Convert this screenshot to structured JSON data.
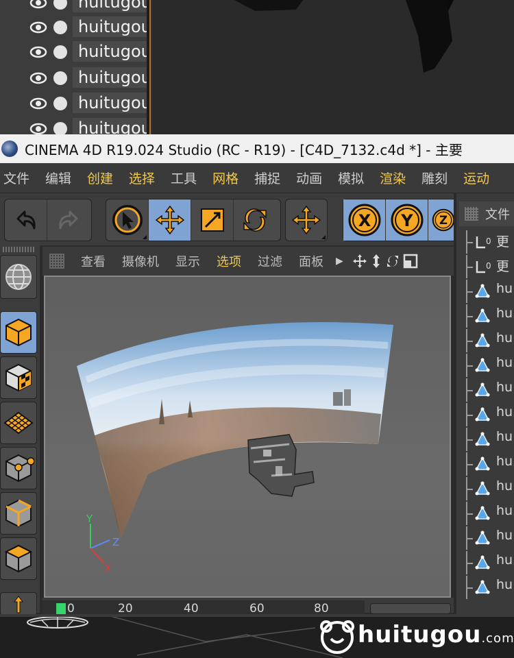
{
  "top_panel": {
    "rows": [
      {
        "label": "huitugou"
      },
      {
        "label": "huitugou"
      },
      {
        "label": "huitugou"
      },
      {
        "label": "huitugou"
      },
      {
        "label": "huitugou"
      },
      {
        "label": "huitugou"
      }
    ]
  },
  "window": {
    "title": "CINEMA 4D R19.024 Studio (RC - R19) - [C4D_7132.c4d *] - 主要"
  },
  "menubar": {
    "items": [
      "文件",
      "编辑",
      "创建",
      "选择",
      "工具",
      "网格",
      "捕捉",
      "动画",
      "模拟",
      "渲染",
      "雕刻",
      "运动"
    ],
    "highlighted": [
      "创建",
      "选择",
      "网格",
      "渲染",
      "运动"
    ]
  },
  "toolbar": {
    "undo": "undo-icon",
    "redo": "redo-icon",
    "tools": [
      "select-arrow-icon",
      "move-icon",
      "scale-icon",
      "rotate-icon",
      "move-icon"
    ],
    "axes": [
      "X",
      "Y",
      "Z"
    ]
  },
  "viewport": {
    "menu": [
      "查看",
      "摄像机",
      "显示",
      "选项",
      "过滤",
      "面板"
    ],
    "highlighted_menu": "选项",
    "axis_labels": {
      "x": "X",
      "y": "Y",
      "z": "Z"
    }
  },
  "timeline": {
    "ticks": [
      "0",
      "20",
      "40",
      "60",
      "80"
    ]
  },
  "object_manager": {
    "title": "文件",
    "items": [
      {
        "icon": "null-object-icon",
        "label": "更"
      },
      {
        "icon": "null-object-icon",
        "label": "更"
      },
      {
        "icon": "polygon-object-icon",
        "label": "hu"
      },
      {
        "icon": "polygon-object-icon",
        "label": "hu"
      },
      {
        "icon": "polygon-object-icon",
        "label": "hu"
      },
      {
        "icon": "polygon-object-icon",
        "label": "hu"
      },
      {
        "icon": "polygon-object-icon",
        "label": "hu"
      },
      {
        "icon": "polygon-object-icon",
        "label": "hu"
      },
      {
        "icon": "polygon-object-icon",
        "label": "hu"
      },
      {
        "icon": "polygon-object-icon",
        "label": "hu"
      },
      {
        "icon": "polygon-object-icon",
        "label": "hu"
      },
      {
        "icon": "polygon-object-icon",
        "label": "hu"
      },
      {
        "icon": "polygon-object-icon",
        "label": "hu"
      },
      {
        "icon": "polygon-object-icon",
        "label": "hu"
      },
      {
        "icon": "polygon-object-icon",
        "label": "hu"
      }
    ]
  },
  "watermark": {
    "text": "huitugou",
    "tld": ".com"
  },
  "colors": {
    "accent_orange": "#f5a623",
    "active_blue": "#7fa4d4",
    "menu_highlight": "#f2c94c",
    "timeline_marker": "#38d36b"
  }
}
